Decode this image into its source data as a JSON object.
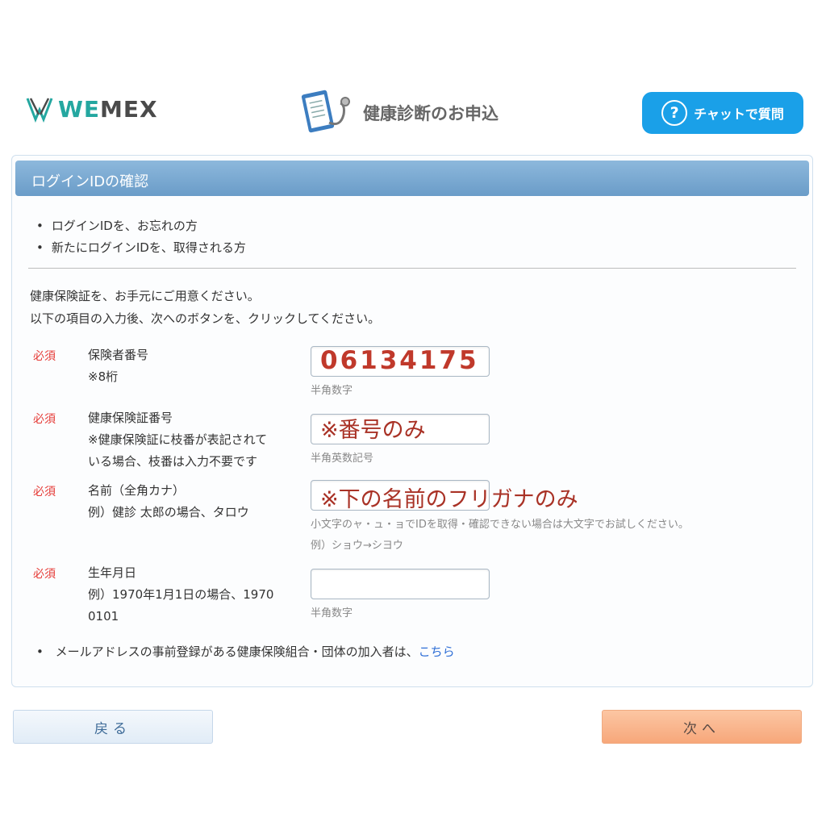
{
  "header": {
    "logo_text_we": "WE",
    "logo_text_mex": "MEX",
    "page_title": "健康診断のお申込",
    "chat_button_label": "チャットで質問",
    "chat_icon_glyph": "?"
  },
  "panel": {
    "title": "ログインIDの確認",
    "bullets": [
      "ログインIDを、お忘れの方",
      "新たにログインIDを、取得される方"
    ],
    "intro_lines": [
      "健康保険証を、お手元にご用意ください。",
      "以下の項目の入力後、次へのボタンを、クリックしてください。"
    ]
  },
  "form": {
    "fields": [
      {
        "required_label": "必須",
        "label_lines": [
          "保険者番号",
          "※8桁"
        ],
        "value": "",
        "hint": "半角数字"
      },
      {
        "required_label": "必須",
        "label_lines": [
          "健康保険証番号",
          "※健康保険証に枝番が表記されて",
          "いる場合、枝番は入力不要です"
        ],
        "value": "",
        "hint": "半角英数記号"
      },
      {
        "required_label": "必須",
        "label_lines": [
          "名前（全角カナ）",
          "例）健診 太郎の場合、タロウ"
        ],
        "value": "",
        "hint": "小文字のャ・ュ・ョでIDを取得・確認できない場合は大文字でお試しください。",
        "hint2": "例）ショウ→シヨウ"
      },
      {
        "required_label": "必須",
        "label_lines": [
          "生年月日",
          "例）1970年1月1日の場合、1970",
          "0101"
        ],
        "value": "",
        "hint": "半角数字"
      }
    ]
  },
  "annotations": {
    "insurer_number": "06134175",
    "card_number_note": "※番号のみ",
    "name_note": "※下の名前のフリガナのみ"
  },
  "mail_note": {
    "text": "メールアドレスの事前登録がある健康保険組合・団体の加入者は、",
    "link": "こちら"
  },
  "buttons": {
    "back": "戻る",
    "next": "次へ"
  },
  "colors": {
    "accent_teal": "#24a7a0",
    "chat_blue": "#1aa0e8",
    "required_red": "#e53935",
    "annotation_red": "#c0392b",
    "link_blue": "#2f6fd6"
  }
}
